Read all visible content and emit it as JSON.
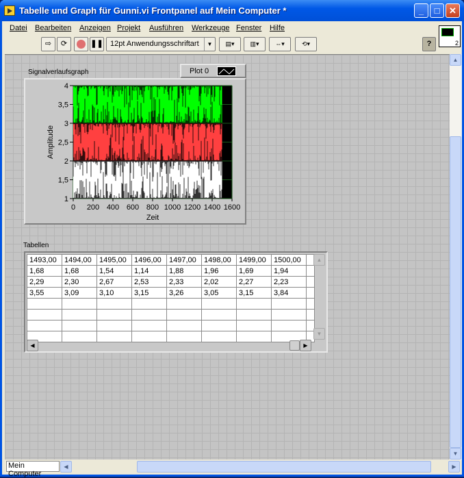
{
  "window": {
    "title": "Tabelle und Graph für Gunni.vi Frontpanel auf Mein Computer *"
  },
  "menu": [
    "Datei",
    "Bearbeiten",
    "Anzeigen",
    "Projekt",
    "Ausführen",
    "Werkzeuge",
    "Fenster",
    "Hilfe"
  ],
  "toolbar": {
    "font_select": "12pt Anwendungsschriftart",
    "help": "?",
    "icons": [
      "run-arrow-icon",
      "run-continuously-icon",
      "abort-icon",
      "pause-icon",
      "align-icon",
      "distribute-icon",
      "resize-icon",
      "reorder-icon"
    ]
  },
  "connector_pane_number": "2",
  "graph": {
    "label": "Signalverlaufsgraph",
    "legend_label": "Plot 0"
  },
  "chart_data": {
    "type": "line",
    "xlabel": "Zeit",
    "ylabel": "Amplitude",
    "xlim": [
      0,
      1600
    ],
    "ylim": [
      1,
      4
    ],
    "xticks": [
      "0",
      "200",
      "400",
      "600",
      "800",
      "1000",
      "1200",
      "1400",
      "1600"
    ],
    "yticks": [
      "1",
      "1,5",
      "2",
      "2,5",
      "3",
      "3,5",
      "4"
    ],
    "grid": true,
    "plot_background": "#000000",
    "series": [
      {
        "color": "#ffffff",
        "range": [
          1,
          2
        ],
        "x_end": 1500
      },
      {
        "color": "#ff4040",
        "range": [
          2,
          3
        ],
        "x_end": 1500
      },
      {
        "color": "#00ff00",
        "range": [
          3,
          4
        ],
        "x_end": 1500
      }
    ]
  },
  "table": {
    "label": "Tabellen",
    "rows": [
      [
        "1493,00",
        "1494,00",
        "1495,00",
        "1496,00",
        "1497,00",
        "1498,00",
        "1499,00",
        "1500,00"
      ],
      [
        "1,68",
        "1,68",
        "1,54",
        "1,14",
        "1,88",
        "1,96",
        "1,69",
        "1,94"
      ],
      [
        "2,29",
        "2,30",
        "2,67",
        "2,53",
        "2,33",
        "2,02",
        "2,27",
        "2,23"
      ],
      [
        "3,55",
        "3,09",
        "3,10",
        "3,15",
        "3,26",
        "3,05",
        "3,15",
        "3,84"
      ],
      [
        "",
        "",
        "",
        "",
        "",
        "",
        "",
        ""
      ],
      [
        "",
        "",
        "",
        "",
        "",
        "",
        "",
        ""
      ],
      [
        "",
        "",
        "",
        "",
        "",
        "",
        "",
        ""
      ],
      [
        "",
        "",
        "",
        "",
        "",
        "",
        "",
        ""
      ]
    ]
  },
  "status": {
    "context": "Mein Computer"
  }
}
